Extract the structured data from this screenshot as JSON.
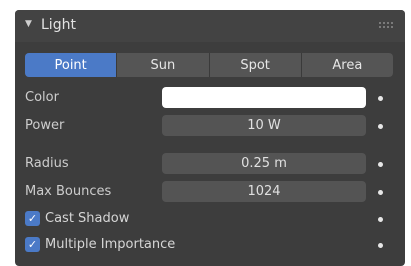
{
  "panel": {
    "title": "Light",
    "collapse_arrow": "▼",
    "expanded": true
  },
  "light_types": [
    {
      "label": "Point",
      "active": true
    },
    {
      "label": "Sun",
      "active": false
    },
    {
      "label": "Spot",
      "active": false
    },
    {
      "label": "Area",
      "active": false
    }
  ],
  "properties": {
    "color_label": "Color",
    "color_value": "#ffffff",
    "power_label": "Power",
    "power_value": "10 W",
    "radius_label": "Radius",
    "radius_value": "0.25 m",
    "max_bounces_label": "Max Bounces",
    "max_bounces_value": "1024"
  },
  "options": {
    "cast_shadow_label": "Cast Shadow",
    "cast_shadow_checked": true,
    "multiple_importance_label": "Multiple Importance",
    "multiple_importance_checked": true,
    "checkmark": "✓"
  },
  "colors": {
    "accent": "#4b7ac7",
    "panel_bg": "#3d3d3d",
    "field_bg": "#545454"
  }
}
